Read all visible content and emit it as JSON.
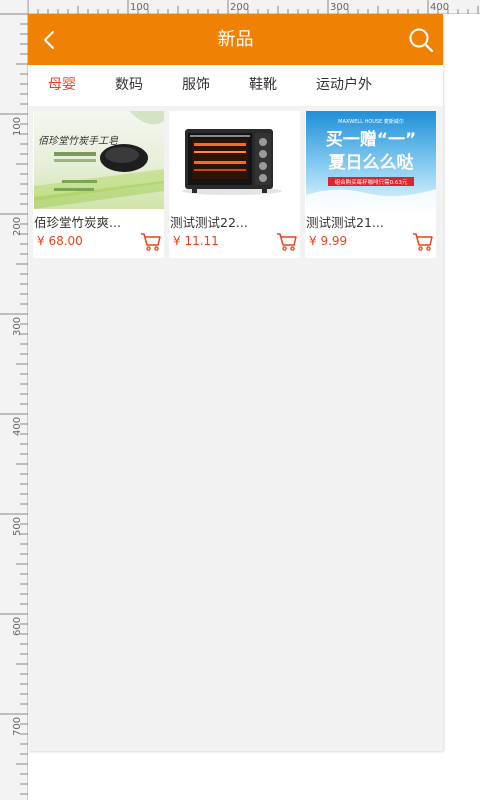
{
  "header": {
    "title": "新品",
    "back_icon": "chevron-left-icon",
    "search_icon": "search-icon"
  },
  "tabs": [
    {
      "label": "母婴",
      "active": true
    },
    {
      "label": "数码",
      "active": false
    },
    {
      "label": "服饰",
      "active": false
    },
    {
      "label": "鞋靴",
      "active": false
    },
    {
      "label": "运动户外",
      "active": false
    }
  ],
  "products": [
    {
      "name": "佰珍堂竹炭爽...",
      "price": "¥ 68.00",
      "image_text": {
        "line1": "佰珍堂竹炭手工皂"
      }
    },
    {
      "name": "测试测试22...",
      "price": "¥ 11.11"
    },
    {
      "name": "测试测试21...",
      "price": "¥ 9.99",
      "image_text": {
        "brand": "MAXWELL HOUSE 麦斯威尔",
        "line1": "买一赠“一”",
        "line2": "夏日么么哒",
        "line3": "组合购买每杯咖啡只需0.63元"
      }
    }
  ],
  "ruler": {
    "top_labels": [
      "100",
      "200",
      "300",
      "400"
    ],
    "left_labels": [
      "100",
      "200",
      "300",
      "400",
      "500",
      "600",
      "700"
    ]
  },
  "colors": {
    "brand_orange": "#ef8204",
    "price_red": "#e8431d",
    "background": "#f2f2f2"
  }
}
